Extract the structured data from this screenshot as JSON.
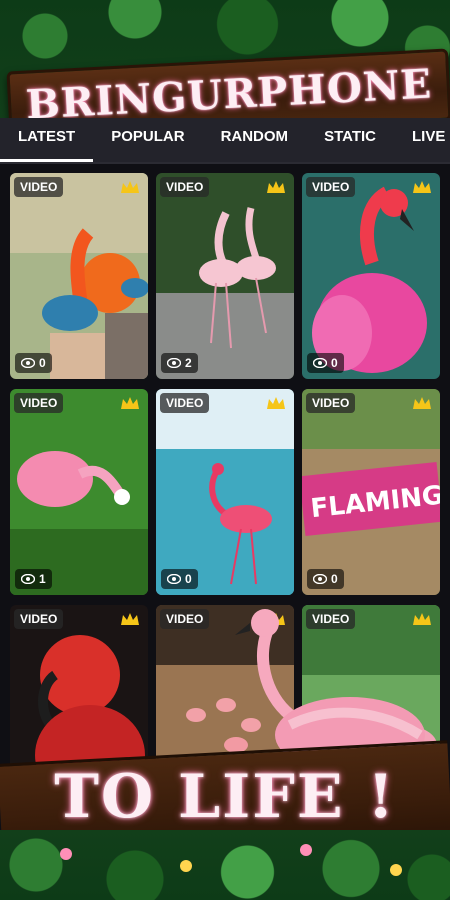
{
  "app": {
    "brand_title": "BRINGURPHONE",
    "slogan": "TO LIFE !"
  },
  "tabs": [
    {
      "label": "LATEST",
      "active": true
    },
    {
      "label": "POPULAR",
      "active": false
    },
    {
      "label": "RANDOM",
      "active": false
    },
    {
      "label": "STATIC",
      "active": false
    },
    {
      "label": "LIVE",
      "active": false
    }
  ],
  "cards": [
    {
      "type_label": "VIDEO",
      "views": "0",
      "premium": true,
      "theme": "hand-feeding"
    },
    {
      "type_label": "VIDEO",
      "views": "2",
      "premium": true,
      "theme": "two-flamingos-water"
    },
    {
      "type_label": "VIDEO",
      "views": "0",
      "premium": true,
      "theme": "colorful-flamingo"
    },
    {
      "type_label": "VIDEO",
      "views": "1",
      "premium": true,
      "theme": "flamingo-grass"
    },
    {
      "type_label": "VIDEO",
      "views": "0",
      "premium": true,
      "theme": "flamingo-lake"
    },
    {
      "type_label": "VIDEO",
      "views": "0",
      "premium": true,
      "theme": "flamingo-wall-sign"
    },
    {
      "type_label": "VIDEO",
      "views": "",
      "premium": true,
      "theme": "red-flamingo-portrait"
    },
    {
      "type_label": "VIDEO",
      "views": "",
      "premium": true,
      "theme": "flamingos-zoo"
    },
    {
      "type_label": "VIDEO",
      "views": "",
      "premium": true,
      "theme": "pink-flamingo-flock"
    }
  ],
  "icons": {
    "crown": "crown-icon",
    "eye": "eye-icon"
  },
  "colors": {
    "tab_bar": "#23232b",
    "background": "#0f0f14",
    "crown": "#f5c518",
    "glow": "#ff6fa8"
  },
  "overlay": {
    "sign_text": "FLAMING"
  }
}
